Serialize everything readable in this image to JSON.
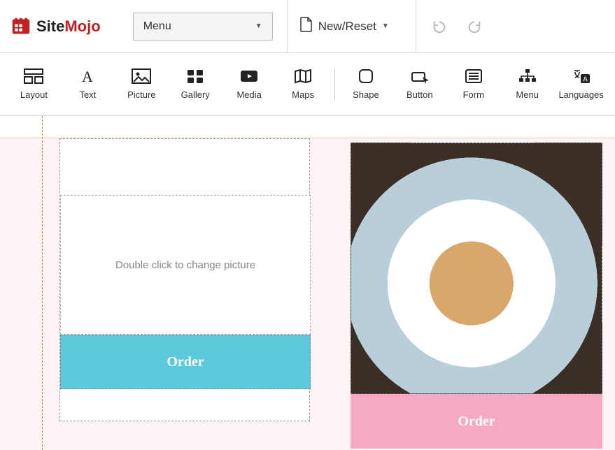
{
  "brand": {
    "name_a": "Site",
    "name_b": "Mojo"
  },
  "topbar": {
    "menu_label": "Menu",
    "new_reset_label": "New/Reset"
  },
  "toolbar": {
    "items": [
      {
        "id": "layout",
        "label": "Layout"
      },
      {
        "id": "text",
        "label": "Text"
      },
      {
        "id": "picture",
        "label": "Picture"
      },
      {
        "id": "gallery",
        "label": "Gallery"
      },
      {
        "id": "media",
        "label": "Media"
      },
      {
        "id": "maps",
        "label": "Maps"
      },
      {
        "id": "shape",
        "label": "Shape"
      },
      {
        "id": "button",
        "label": "Button"
      },
      {
        "id": "form",
        "label": "Form"
      },
      {
        "id": "menu",
        "label": "Menu"
      },
      {
        "id": "languages",
        "label": "Languages"
      }
    ]
  },
  "canvas": {
    "placeholder_text": "Double click to change picture",
    "order_label_left": "Order",
    "order_label_right": "Order",
    "colors": {
      "left_button_bg": "#5bc8dc",
      "right_button_bg": "#f7a8c4",
      "guide": "#e07a2a"
    }
  }
}
